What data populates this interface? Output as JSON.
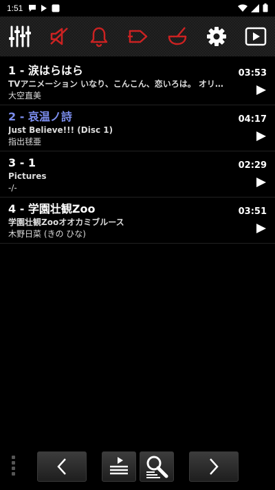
{
  "status_bar": {
    "time": "1:51",
    "icons": [
      "notification-icon",
      "play-icon",
      "app-icon"
    ],
    "right_icons": [
      "wifi-icon",
      "cell-signal-icon",
      "battery-icon"
    ]
  },
  "toolbar": {
    "buttons": [
      {
        "name": "equalizer-icon",
        "color": "#ffffff"
      },
      {
        "name": "speaker-muted-icon",
        "color": "#cc2222"
      },
      {
        "name": "bell-icon",
        "color": "#cc2222"
      },
      {
        "name": "tag-icon",
        "color": "#cc2222"
      },
      {
        "name": "mortar-pestle-icon",
        "color": "#cc2222"
      },
      {
        "name": "gear-icon",
        "color": "#ffffff"
      },
      {
        "name": "play-screen-icon",
        "color": "#ffffff"
      }
    ]
  },
  "tracks": [
    {
      "title": "1 - 涙はらはら",
      "album": "TVアニメーション いなり、こんこん、恋いろは。 オリジナルサウンドトラック",
      "artist": "大空直美",
      "duration": "03:53",
      "current": false
    },
    {
      "title": "2 - 哀温ノ詩",
      "album": "Just Believe!!! (Disc 1)",
      "artist": "指出毬亜",
      "duration": "04:17",
      "current": true
    },
    {
      "title": "3 - 1",
      "album": "Pictures",
      "artist": "-/-",
      "duration": "02:29",
      "current": false
    },
    {
      "title": "4 - 学園壮観Zoo",
      "album": "学園壮観Zooオオカミブルース",
      "artist": "木野日菜 (きの ひな)",
      "duration": "03:51",
      "current": false
    }
  ],
  "colors": {
    "current_track": "#7d8ff0",
    "accent_red": "#cc2222"
  }
}
